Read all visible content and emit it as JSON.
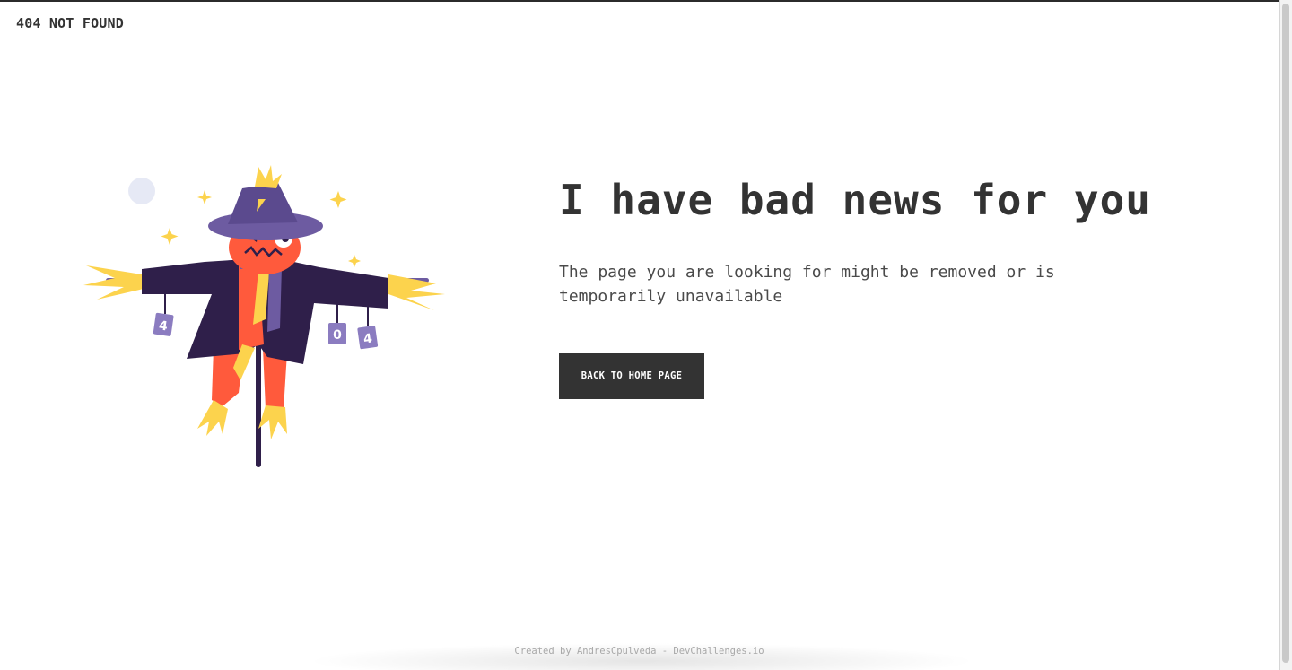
{
  "header": {
    "brand": "404 NOT FOUND"
  },
  "main": {
    "headline": "I have bad news for you",
    "message": "The page you are looking for might be removed or is temporarily unavailable",
    "button_label": "BACK TO HOME PAGE"
  },
  "illustration": {
    "name": "scarecrow-illustration",
    "cans": [
      "4",
      "0",
      "4"
    ]
  },
  "footer": {
    "credit": "Created by AndresCpulveda - DevChallenges.io"
  },
  "colors": {
    "text": "#333333",
    "button_bg": "#333333",
    "button_text": "#ffffff",
    "scarecrow_coat": "#2f1f4a",
    "scarecrow_hat": "#5b4a8e",
    "scarecrow_face": "#ff5a3c",
    "straw": "#fcd34d",
    "footer_text": "#a8a8a8"
  }
}
